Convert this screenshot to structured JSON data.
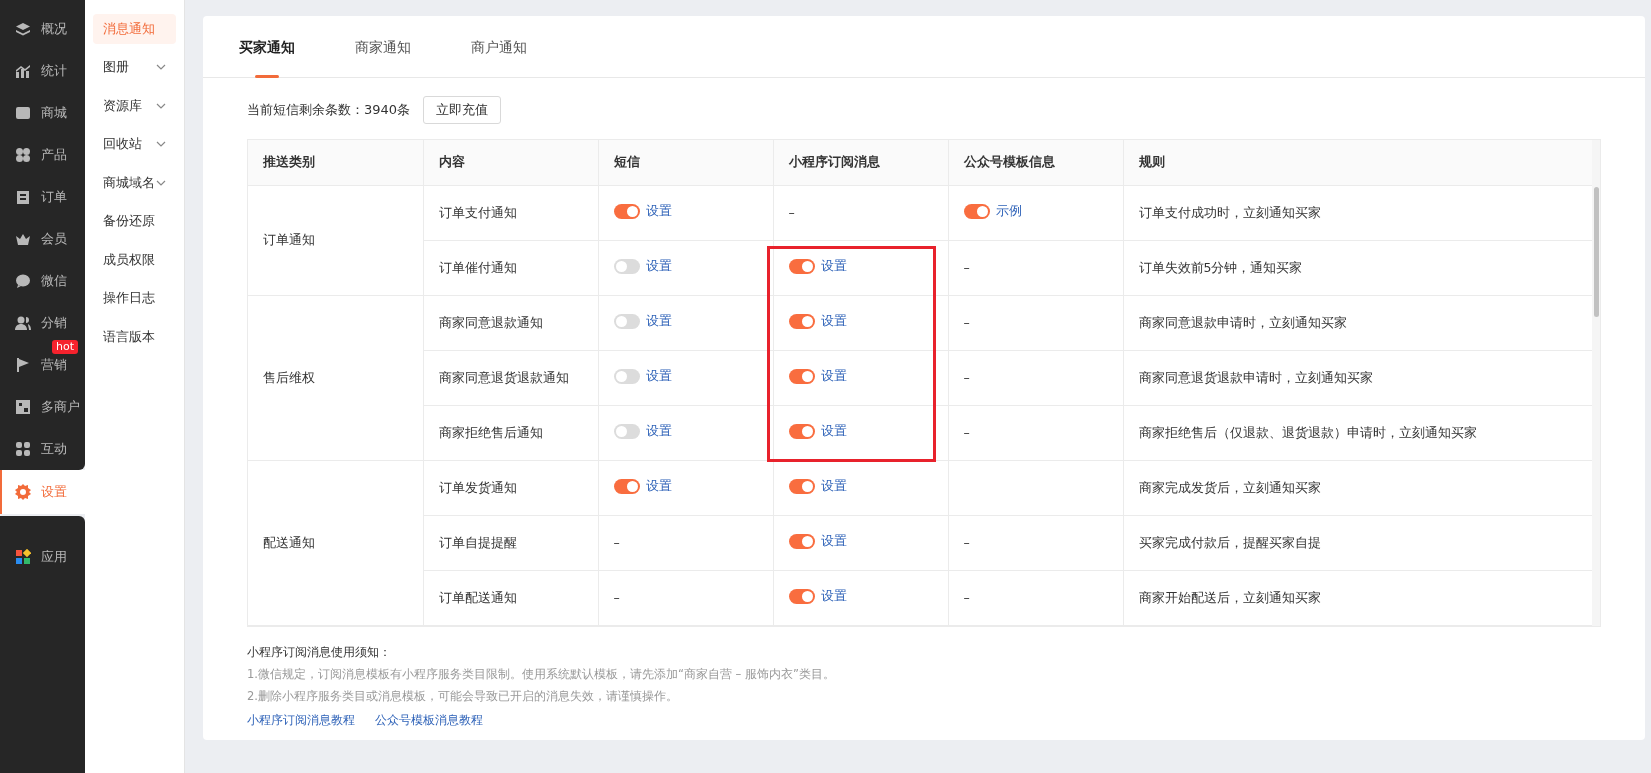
{
  "main_nav": [
    {
      "label": "概况",
      "selected": false
    },
    {
      "label": "统计",
      "selected": false
    },
    {
      "label": "商城",
      "selected": false
    },
    {
      "label": "产品",
      "selected": false
    },
    {
      "label": "订单",
      "selected": false
    },
    {
      "label": "会员",
      "selected": false
    },
    {
      "label": "微信",
      "selected": false
    },
    {
      "label": "分销",
      "selected": false
    },
    {
      "label": "营销",
      "selected": false,
      "badge": "hot"
    },
    {
      "label": "多商户",
      "selected": false
    },
    {
      "label": "互动",
      "selected": false
    },
    {
      "label": "设置",
      "selected": true
    },
    {
      "label": "应用",
      "selected": false
    }
  ],
  "sub_nav": [
    {
      "label": "消息通知",
      "selected": true,
      "expandable": false
    },
    {
      "label": "图册",
      "selected": false,
      "expandable": true
    },
    {
      "label": "资源库",
      "selected": false,
      "expandable": true
    },
    {
      "label": "回收站",
      "selected": false,
      "expandable": true
    },
    {
      "label": "商城域名",
      "selected": false,
      "expandable": true
    },
    {
      "label": "备份还原",
      "selected": false,
      "expandable": false
    },
    {
      "label": "成员权限",
      "selected": false,
      "expandable": false
    },
    {
      "label": "操作日志",
      "selected": false,
      "expandable": false
    },
    {
      "label": "语言版本",
      "selected": false,
      "expandable": false
    }
  ],
  "tabs": [
    {
      "label": "买家通知",
      "selected": true
    },
    {
      "label": "商家通知",
      "selected": false
    },
    {
      "label": "商户通知",
      "selected": false
    }
  ],
  "sms_balance": "当前短信剩余条数：3940条",
  "recharge_button": "立即充值",
  "table": {
    "columns": [
      "推送类别",
      "内容",
      "短信",
      "小程序订阅消息",
      "公众号模板信息",
      "规则"
    ],
    "groups": [
      {
        "category": "订单通知",
        "rows": [
          {
            "content": "订单支付通知",
            "sms": {
              "kind": "toggle",
              "on": true,
              "link": "设置"
            },
            "mini": {
              "kind": "dash",
              "text": "–"
            },
            "official": {
              "kind": "toggle",
              "on": true,
              "link": "示例"
            },
            "rule": "订单支付成功时，立刻通知买家"
          },
          {
            "content": "订单催付通知",
            "sms": {
              "kind": "toggle",
              "on": false,
              "link": "设置"
            },
            "mini": {
              "kind": "toggle",
              "on": true,
              "link": "设置",
              "highlighted": true
            },
            "official": {
              "kind": "dash",
              "text": "–"
            },
            "rule": "订单失效前5分钟，通知买家"
          }
        ]
      },
      {
        "category": "售后维权",
        "rows": [
          {
            "content": "商家同意退款通知",
            "sms": {
              "kind": "toggle",
              "on": false,
              "link": "设置"
            },
            "mini": {
              "kind": "toggle",
              "on": true,
              "link": "设置",
              "highlighted": true
            },
            "official": {
              "kind": "dash",
              "text": "–"
            },
            "rule": "商家同意退款申请时，立刻通知买家"
          },
          {
            "content": "商家同意退货退款通知",
            "sms": {
              "kind": "toggle",
              "on": false,
              "link": "设置"
            },
            "mini": {
              "kind": "toggle",
              "on": true,
              "link": "设置",
              "highlighted": true
            },
            "official": {
              "kind": "dash",
              "text": "–"
            },
            "rule": "商家同意退货退款申请时，立刻通知买家"
          },
          {
            "content": "商家拒绝售后通知",
            "sms": {
              "kind": "toggle",
              "on": false,
              "link": "设置"
            },
            "mini": {
              "kind": "toggle",
              "on": true,
              "link": "设置",
              "highlighted": true
            },
            "official": {
              "kind": "dash",
              "text": "–"
            },
            "rule": "商家拒绝售后（仅退款、退货退款）申请时，立刻通知买家"
          }
        ]
      },
      {
        "category": "配送通知",
        "rows": [
          {
            "content": "订单发货通知",
            "sms": {
              "kind": "toggle",
              "on": true,
              "link": "设置"
            },
            "mini": {
              "kind": "toggle",
              "on": true,
              "link": "设置"
            },
            "official": {
              "kind": "empty"
            },
            "rule": "商家完成发货后，立刻通知买家"
          },
          {
            "content": "订单自提提醒",
            "sms": {
              "kind": "dash",
              "text": "–"
            },
            "mini": {
              "kind": "toggle",
              "on": true,
              "link": "设置"
            },
            "official": {
              "kind": "dash",
              "text": "–"
            },
            "rule": "买家完成付款后，提醒买家自提"
          },
          {
            "content": "订单配送通知",
            "sms": {
              "kind": "dash",
              "text": "–"
            },
            "mini": {
              "kind": "toggle",
              "on": true,
              "link": "设置"
            },
            "official": {
              "kind": "dash",
              "text": "–"
            },
            "rule": "商家开始配送后，立刻通知买家"
          }
        ]
      }
    ]
  },
  "notes": {
    "title": "小程序订阅消息使用须知：",
    "lines": [
      "1.微信规定，订阅消息模板有小程序服务类目限制。使用系统默认模板，请先添加“商家自营 – 服饰内衣”类目。",
      "2.删除小程序服务类目或消息模板，可能会导致已开启的消息失效，请谨慎操作。"
    ],
    "links": [
      "小程序订阅消息教程",
      "公众号模板消息教程"
    ]
  }
}
